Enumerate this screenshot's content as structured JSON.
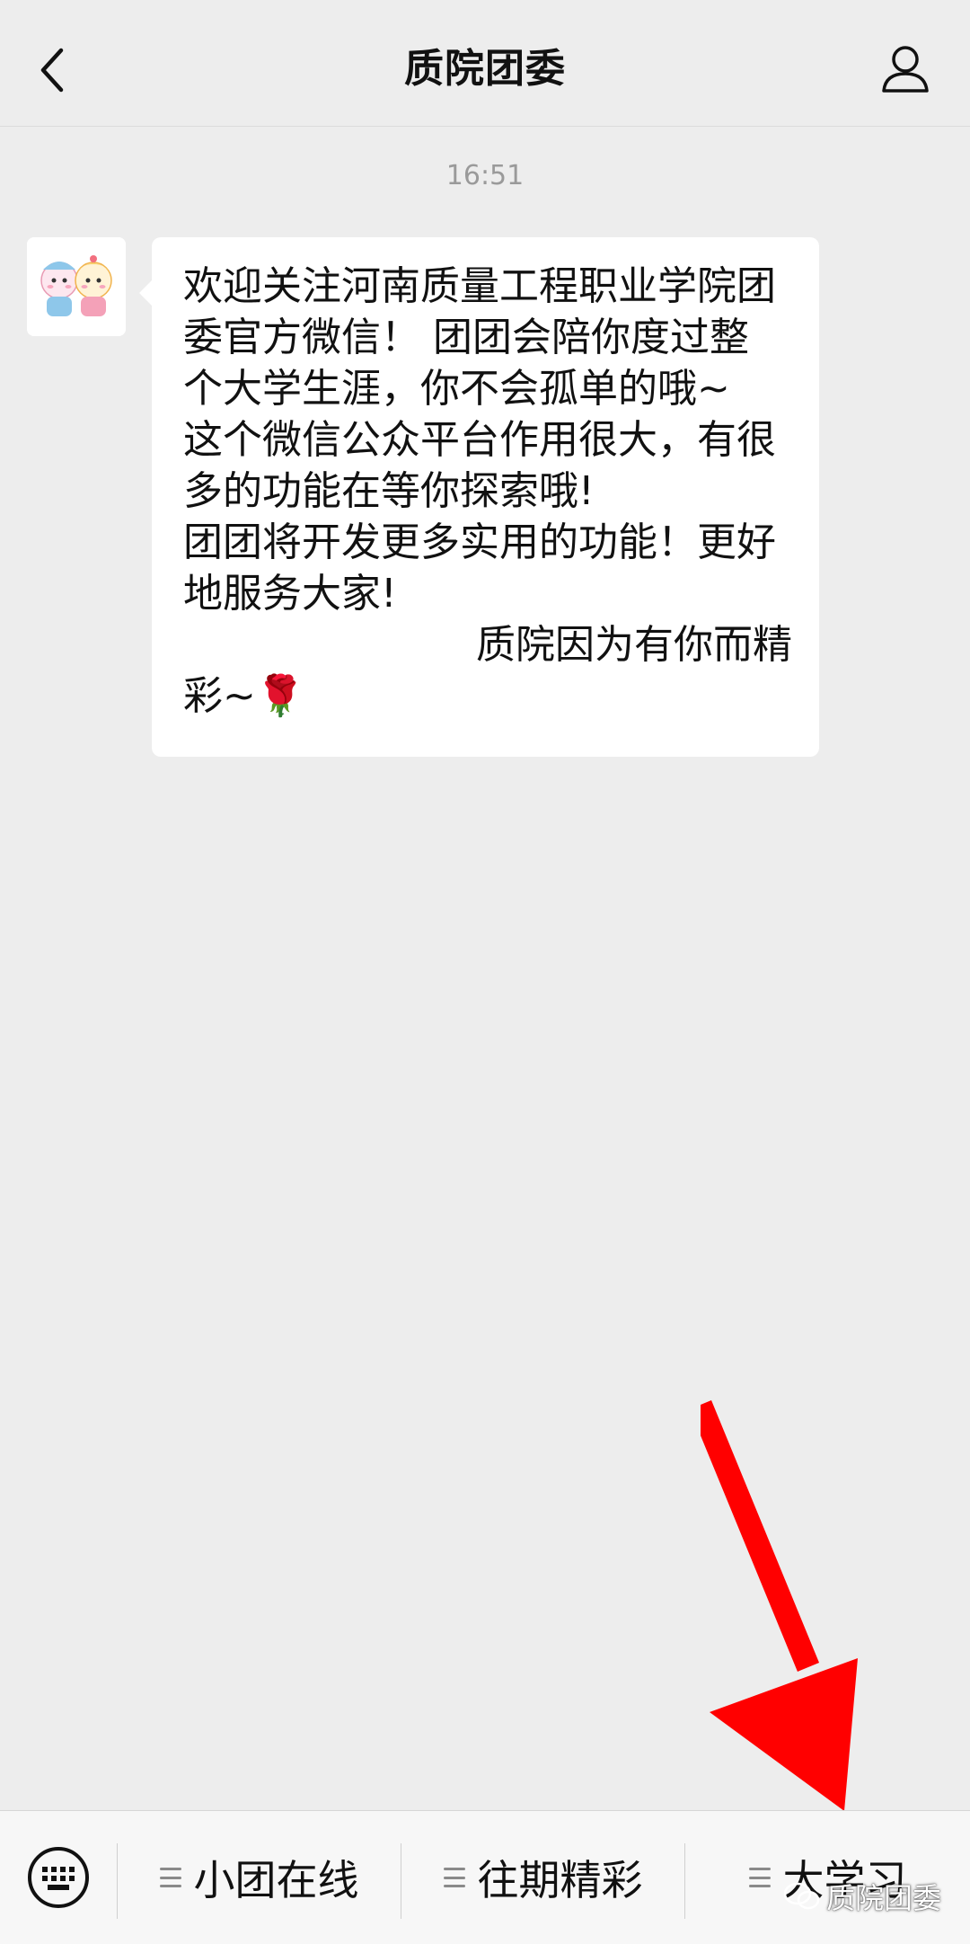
{
  "header": {
    "title": "质院团委",
    "back_icon": "chevron-left-icon",
    "profile_icon": "person-icon"
  },
  "chat": {
    "timestamp": "16:51",
    "message": {
      "lines": [
        "欢迎关注河南质量工程职业学院团",
        "委官方微信！ 团团会陪你度过整",
        "个大学生涯，你不会孤单的哦~",
        "这个微信公众平台作用很大，有很",
        "多的功能在等你探索哦!",
        "团团将开发更多实用的功能！更好",
        "地服务大家!",
        "质院因为有你而精",
        "彩~🌹"
      ]
    }
  },
  "bottom_menu": {
    "keyboard_icon": "keyboard-icon",
    "items": [
      {
        "label": "小团在线"
      },
      {
        "label": "往期精彩"
      },
      {
        "label": "大学习"
      }
    ]
  },
  "watermark": {
    "text": "质院团委"
  },
  "colors": {
    "background": "#ededed",
    "bubble": "#ffffff",
    "arrow": "#ff0000"
  }
}
